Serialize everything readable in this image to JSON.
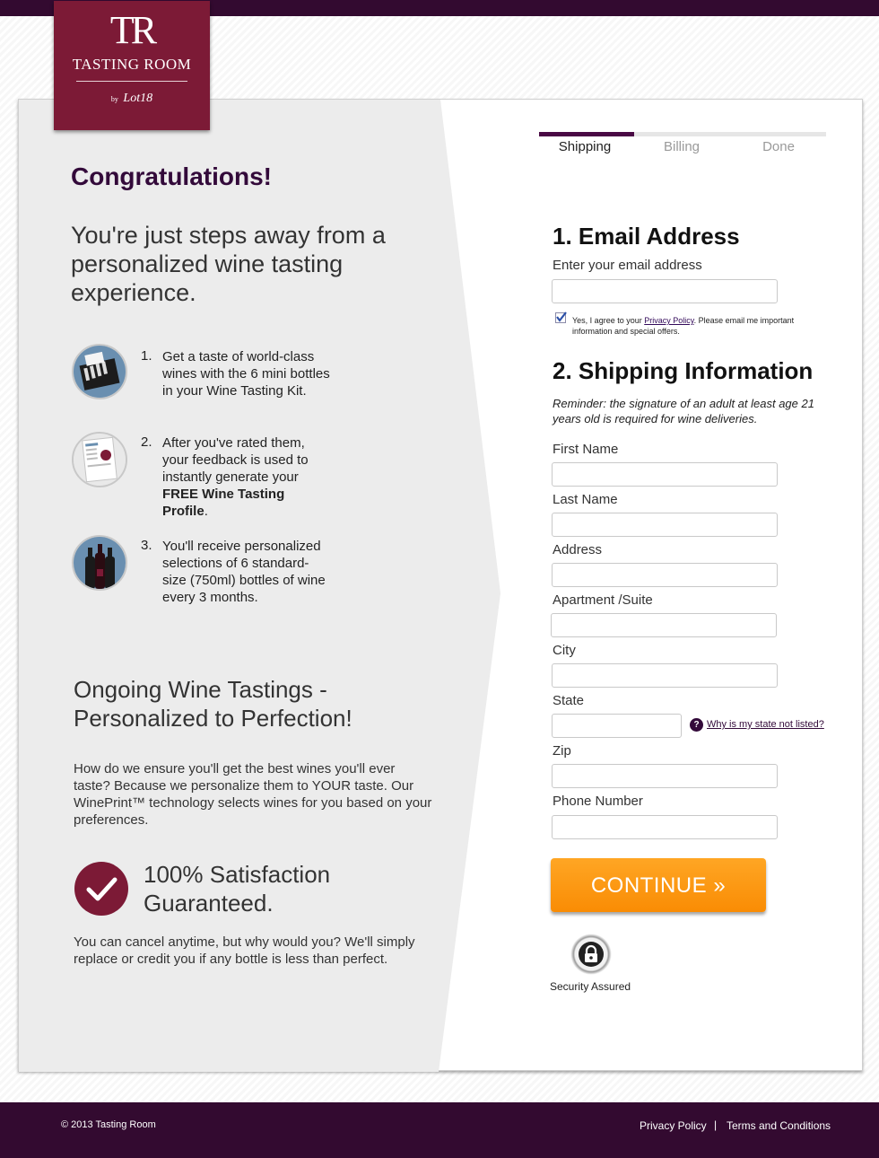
{
  "brand": {
    "mark": "TR",
    "name": "TASTING ROOM",
    "by_prefix": "by",
    "by_name": "Lot18"
  },
  "intro": {
    "congrats": "Congratulations!",
    "headline": "You're just steps away from a personalized wine tasting experience."
  },
  "steps": [
    {
      "num": "1.",
      "text": "Get a taste of world-class wines with the 6 mini bottles in your Wine Tasting Kit.",
      "icon": "wine-kit-icon"
    },
    {
      "num": "2.",
      "text_before": "After you've rated them, your feedback is used to instantly generate your ",
      "text_bold": "FREE Wine Tasting Profile",
      "text_after": ".",
      "icon": "tasting-profile-icon"
    },
    {
      "num": "3.",
      "text": "You'll receive personalized selections of 6 standard-size (750ml) bottles of wine every 3 months.",
      "icon": "wine-bottles-icon"
    }
  ],
  "ongoing": {
    "title": "Ongoing Wine Tastings - Personalized to Perfection!",
    "body": "How do we ensure you'll get the best wines you'll ever taste? Because we personalize them to YOUR taste. Our WinePrint™ technology selects wines for you based on your preferences."
  },
  "guarantee": {
    "title": "100% Satisfaction Guaranteed.",
    "body": "You can cancel anytime, but why would you? We'll simply replace or credit you if any bottle is less than perfect."
  },
  "progress": {
    "tabs": [
      "Shipping",
      "Billing",
      "Done"
    ],
    "active": 0
  },
  "email_section": {
    "heading": "1. Email Address",
    "label": "Enter your email address",
    "value": "",
    "consent_before": "Yes, I agree to your ",
    "consent_link": "Privacy Policy",
    "consent_after": ". Please email me important information and special offers.",
    "consent_checked": true
  },
  "shipping_section": {
    "heading": "2. Shipping Information",
    "reminder": "Reminder: the signature of an adult at least age 21 years old is required for wine deliveries.",
    "fields": {
      "first_name": {
        "label": "First Name",
        "value": ""
      },
      "last_name": {
        "label": "Last Name",
        "value": ""
      },
      "address": {
        "label": "Address",
        "value": ""
      },
      "apartment": {
        "label": "Apartment /Suite",
        "value": ""
      },
      "city": {
        "label": "City",
        "value": ""
      },
      "state": {
        "label": "State",
        "value": ""
      },
      "zip": {
        "label": "Zip",
        "value": ""
      },
      "phone": {
        "label": "Phone Number",
        "value": ""
      }
    },
    "state_help_icon": "?",
    "state_help": "Why is my state not listed?"
  },
  "continue_label": "CONTINUE »",
  "security_label": "Security Assured",
  "footer": {
    "copyright": "© 2013 Tasting Room",
    "privacy": "Privacy Policy",
    "separator": "|",
    "terms": "Terms and Conditions"
  },
  "colors": {
    "brand_purple": "#330a30",
    "logo_wine": "#7c1a36",
    "button_orange": "#f98c04"
  }
}
